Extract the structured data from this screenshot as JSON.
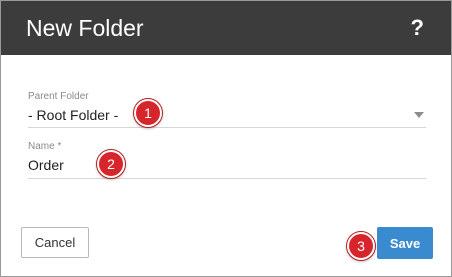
{
  "dialog": {
    "title": "New Folder",
    "help_label": "?"
  },
  "fields": {
    "parent_folder": {
      "label": "Parent Folder",
      "value": "- Root Folder -"
    },
    "name": {
      "label": "Name *",
      "value": "Order"
    }
  },
  "buttons": {
    "cancel_label": "Cancel",
    "save_label": "Save"
  },
  "callouts": [
    "1",
    "2",
    "3"
  ],
  "colors": {
    "header_bg": "#3c3c3c",
    "save_button": "#3a8ad0",
    "callout": "#d7262b"
  }
}
